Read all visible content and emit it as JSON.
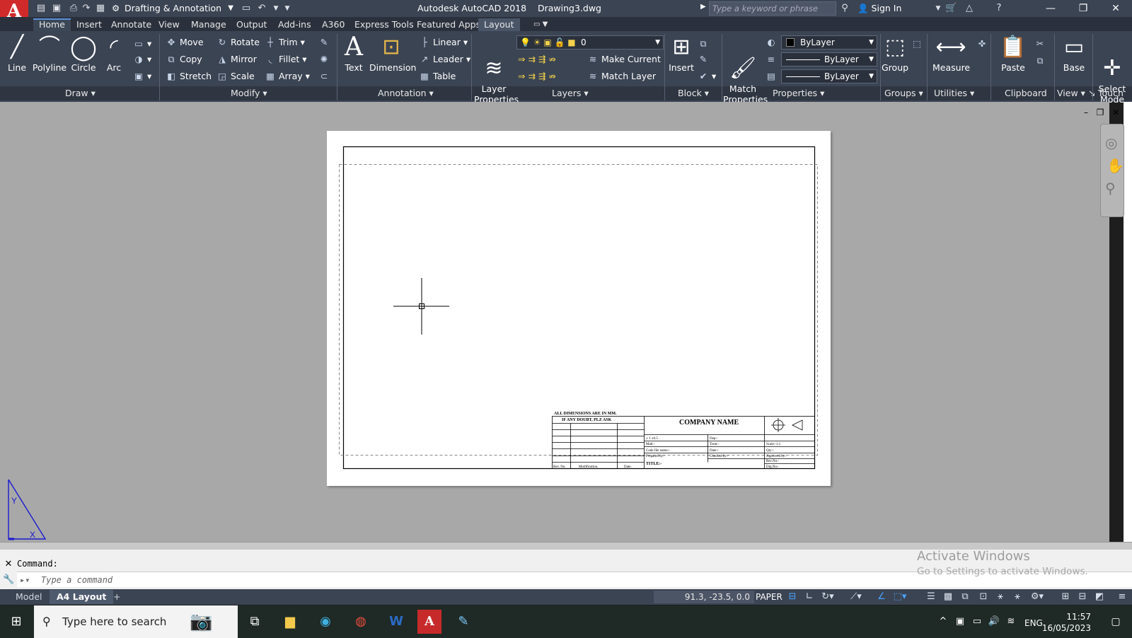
{
  "title_bar": {
    "app_letter": "A",
    "workspace": "Drafting & Annotation",
    "title": "Autodesk AutoCAD 2018    Drawing3.dwg",
    "search_placeholder": "Type a keyword or phrase",
    "sign_in": "Sign In"
  },
  "ribbon_tabs": [
    "Home",
    "Insert",
    "Annotate",
    "View",
    "Manage",
    "Output",
    "Add-ins",
    "A360",
    "Express Tools",
    "Featured Apps",
    "Layout"
  ],
  "draw": {
    "line": "Line",
    "polyline": "Polyline",
    "circle": "Circle",
    "arc": "Arc",
    "title": "Draw"
  },
  "modify": {
    "move": "Move",
    "rotate": "Rotate",
    "trim": "Trim",
    "copy": "Copy",
    "mirror": "Mirror",
    "fillet": "Fillet",
    "stretch": "Stretch",
    "scale": "Scale",
    "array": "Array",
    "title": "Modify"
  },
  "annotation": {
    "text": "Text",
    "dimension": "Dimension",
    "linear": "Linear",
    "leader": "Leader",
    "table": "Table",
    "title": "Annotation"
  },
  "layers": {
    "layer_properties": "Layer\nProperties",
    "layer_value": "0",
    "make_current": "Make Current",
    "match_layer": "Match Layer",
    "title": "Layers"
  },
  "block": {
    "insert": "Insert",
    "title": "Block"
  },
  "properties": {
    "match": "Match\nProperties",
    "color": "ByLayer",
    "linetype": "ByLayer",
    "lineweight": "ByLayer",
    "title": "Properties"
  },
  "groups": {
    "group": "Group",
    "title": "Groups"
  },
  "utilities": {
    "measure": "Measure",
    "title": "Utilities"
  },
  "clipboard": {
    "paste": "Paste",
    "title": "Clipboard"
  },
  "view": {
    "base": "Base",
    "title": "View"
  },
  "touch": {
    "select_mode": "Select\nMode",
    "title": "Touch"
  },
  "titleblock": {
    "note1": "ALL DIMENSIONS ARE IN MM.",
    "note2": "IF ANY DOUBT, PLZ ASK",
    "company": "COMPANY NAME",
    "tol": "± 1 ±0.5",
    "matl": "Matl:-",
    "code_file": "Code file name:-",
    "prepared": "Prepared by:-",
    "title_lbl": "TITLE:-",
    "dep": "Dep:-",
    "treat": "Treat:-",
    "date": "Date:-",
    "checked": "Checked by:-",
    "scale": "Scale:-1:1",
    "qty": "Qty:-",
    "approved": "Approved by:-",
    "rev_no": "Rev.No:-",
    "drg_no": "Drg.No:-",
    "col_rev": "Rev. No.",
    "col_mod": "Modification.",
    "col_date": "Date."
  },
  "command": {
    "label": "Command:",
    "placeholder": "Type a command"
  },
  "activation": {
    "line1": "Activate Windows",
    "line2": "Go to Settings to activate Windows."
  },
  "layout_tabs": [
    "Model",
    "A4 Layout"
  ],
  "status": {
    "coords": "91.3, -23.5, 0.0",
    "space": "PAPER"
  },
  "taskbar": {
    "search": "Type here to search",
    "lang": "ENG",
    "time": "11:57",
    "date": "16/05/2023"
  }
}
